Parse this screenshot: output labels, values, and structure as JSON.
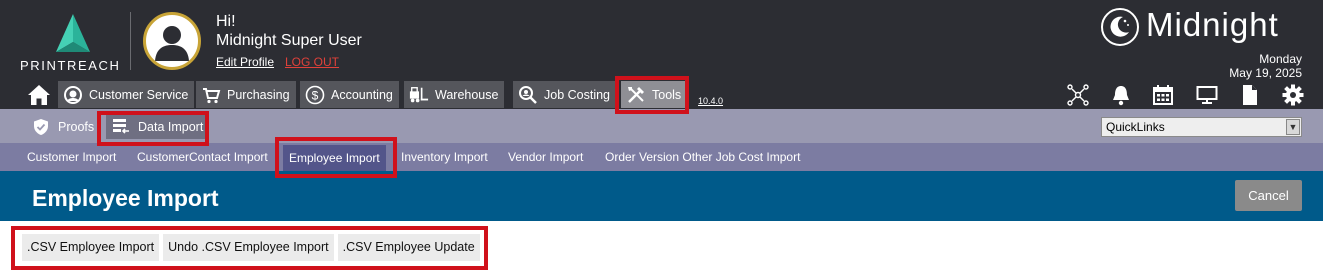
{
  "header": {
    "logo_text": "PRINTREACH",
    "greeting": "Hi!",
    "user_name": "Midnight Super User",
    "edit_profile": "Edit Profile",
    "logout": "LOG OUT",
    "brand_name": "Midnight",
    "date_day": "Monday",
    "date_full": "May 19, 2025",
    "version": "10.4.0",
    "colors": {
      "background": "#2c2d33",
      "logout": "#e0413a",
      "avatar_ring": "#c8a437"
    }
  },
  "main_nav": {
    "home_icon": "home-icon",
    "tabs": [
      {
        "label": "Customer Service",
        "icon": "customer-service-icon"
      },
      {
        "label": "Purchasing",
        "icon": "cart-icon"
      },
      {
        "label": "Accounting",
        "icon": "dollar-icon"
      },
      {
        "label": "Warehouse",
        "icon": "forklift-icon"
      },
      {
        "label": "Job Costing",
        "icon": "magnifier-icon"
      },
      {
        "label": "Tools",
        "icon": "tools-icon",
        "active": true
      }
    ],
    "right_icons": [
      "network-icon",
      "bell-icon",
      "calendar-icon",
      "monitor-icon",
      "document-icon",
      "gear-icon"
    ]
  },
  "sub_nav": {
    "items": [
      {
        "label": "Proofs",
        "icon": "shield-icon"
      },
      {
        "label": "Data Import",
        "icon": "data-import-icon",
        "active": true
      }
    ],
    "quicklinks": "QuickLinks"
  },
  "import_tabs": [
    {
      "label": "Customer Import"
    },
    {
      "label": "CustomerContact Import"
    },
    {
      "label": "Employee Import",
      "active": true
    },
    {
      "label": "Inventory Import"
    },
    {
      "label": "Vendor Import"
    },
    {
      "label": "Order Version Other Job Cost Import"
    }
  ],
  "page": {
    "title": "Employee Import",
    "cancel": "Cancel",
    "accent": "#005a8a"
  },
  "actions": [
    ".CSV Employee Import",
    "Undo .CSV Employee Import",
    ".CSV Employee Update"
  ]
}
